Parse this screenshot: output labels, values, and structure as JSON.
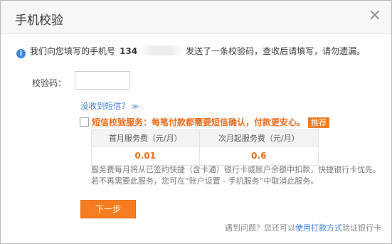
{
  "dialog": {
    "title": "手机校验",
    "close_symbol": "×"
  },
  "notice": {
    "icon": "info-icon",
    "text_before": "我们向您填写的手机号",
    "phone_prefix": "134",
    "text_after": "发送了一条校验码，查收后请填写，请勿遗漏。"
  },
  "form": {
    "code_label": "校验码：",
    "code_value": "",
    "resend_link": "没收到短信？"
  },
  "service": {
    "checked": false,
    "title": "短信校验服务：每笔付款都需要短信确认，付款更安心。",
    "badge": "推荐",
    "table": {
      "headers": [
        "首月服务费（元/月）",
        "次月起服务费（元/月）"
      ],
      "values": [
        "0.01",
        "0.6"
      ]
    },
    "desc_line1": "服务费每月将从已签约快捷（含卡通）银行卡或账户余额中扣款，快捷银行卡优先。",
    "desc_line2": "若不再需要此服务，您可在“账户设置 - 手机服务”中取消此服务。"
  },
  "next_button": "下一步",
  "footer": {
    "text_before": "遇到问题？您还可以",
    "link": "使用打款方式",
    "text_after": "验证银行卡"
  },
  "colors": {
    "accent": "#f57d20",
    "link": "#3c7ad0",
    "warning_text": "#e66a1a"
  }
}
